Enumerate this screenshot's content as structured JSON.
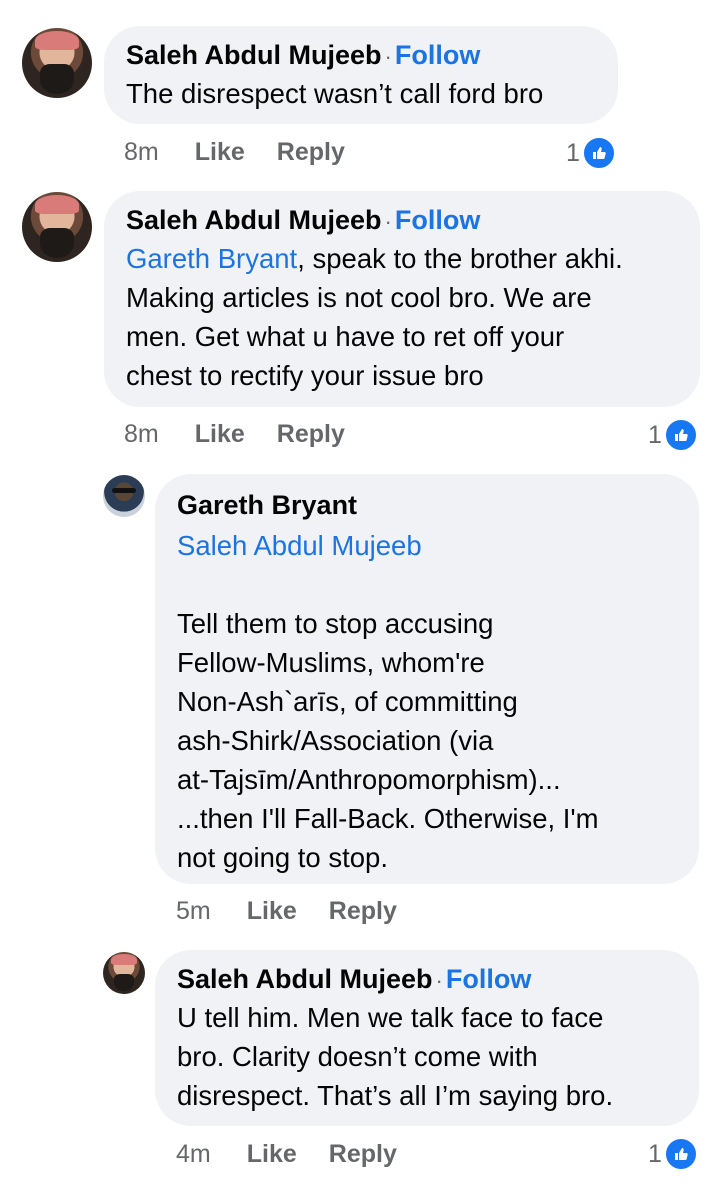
{
  "comments": [
    {
      "author": "Saleh Abdul Mujeeb",
      "follow": "Follow",
      "text": "The disrespect wasn’t call ford bro",
      "time": "8m",
      "like": "Like",
      "reply": "Reply",
      "reactions": "1"
    },
    {
      "author": "Saleh Abdul Mujeeb",
      "follow": "Follow",
      "mention": "Gareth Bryant",
      "text_lines": [
        ", speak to the brother akhi.",
        "Making articles is not cool bro. We are",
        "men. Get what u have to ret off your",
        "chest to rectify your issue bro"
      ],
      "time": "8m",
      "like": "Like",
      "reply": "Reply",
      "reactions": "1"
    }
  ],
  "replies": [
    {
      "author": "Gareth Bryant",
      "mention": "Saleh Abdul Mujeeb",
      "text_lines": [
        "Tell them to stop accusing",
        "Fellow-Muslims, whom're",
        "Non-Ash`arīs, of committing",
        "ash-Shirk/Association (via",
        "at-Tajsīm/Anthropomorphism)...",
        "...then I'll Fall-Back. Otherwise, I'm",
        "not going to stop."
      ],
      "time": "5m",
      "like": "Like",
      "reply": "Reply"
    },
    {
      "author": "Saleh Abdul Mujeeb",
      "follow": "Follow",
      "text_lines": [
        "U tell him. Men we talk face to face",
        "bro. Clarity doesn’t come with",
        "disrespect. That’s all I’m saying bro."
      ],
      "time": "4m",
      "like": "Like",
      "reply": "Reply",
      "reactions": "1"
    }
  ],
  "icons": {
    "reaction": "like-thumbs-up-icon"
  },
  "colors": {
    "link": "#1b74e4",
    "bubble": "#f0f2f5",
    "meta": "#65676b",
    "like_badge": "#1877f2"
  }
}
